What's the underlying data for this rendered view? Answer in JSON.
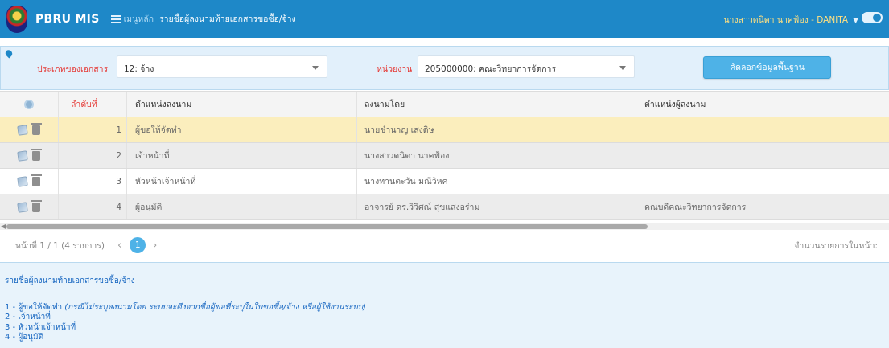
{
  "header": {
    "app_title": "PBRU MIS",
    "menu_label": "เมนูหลัก",
    "page_name": "รายชื่อผู้ลงนามท้ายเอกสารขอซื้อ/จ้าง",
    "user": "นางสาวดนิตา นาคฟ้อง - DANITA"
  },
  "filters": {
    "doc_type_label": "ประเภทของเอกสาร",
    "doc_type_value": "12: จ้าง",
    "unit_label": "หน่วยงาน",
    "unit_value": "205000000: คณะวิทยาการจัดการ",
    "copy_button": "คัดลอกข้อมูลพื้นฐาน"
  },
  "table": {
    "columns": [
      "ลำดับที่",
      "ตำแหน่งลงนาม",
      "ลงนามโดย",
      "ตำแหน่งผู้ลงนาม"
    ],
    "rows": [
      {
        "order": "1",
        "position": "ผู้ขอให้จัดทำ",
        "signer": "นายชำนาญ เส่งดิษ",
        "signer_position": ""
      },
      {
        "order": "2",
        "position": "เจ้าหน้าที่",
        "signer": "นางสาวดนิตา นาคฟ้อง",
        "signer_position": ""
      },
      {
        "order": "3",
        "position": "หัวหน้าเจ้าหน้าที่",
        "signer": "นางทานตะวัน มณีวิหค",
        "signer_position": ""
      },
      {
        "order": "4",
        "position": "ผู้อนุมัติ",
        "signer": "อาจารย์ ดร.วิวิศณ์ สุขแสงอร่าม",
        "signer_position": "คณบดีคณะวิทยาการจัดการ"
      }
    ]
  },
  "pager": {
    "info": "หน้าที่ 1 / 1 (4 รายการ)",
    "prev": "‹",
    "current": "1",
    "next": "›",
    "per_page_label": "จำนวนรายการในหน้า:"
  },
  "help": {
    "title": "รายชื่อผู้ลงนามท้ายเอกสารขอซื้อ/จ้าง",
    "line1_prefix": "1 - ผู้ขอให้จัดทำ",
    "line1_note": "(กรณีไม่ระบุลงนามโดย ระบบจะดึงจากชื่อผู้ขอที่ระบุในใบขอซื้อ/จ้าง หรือผู้ใช้งานระบบ)",
    "line2": "2 - เจ้าหน้าที่",
    "line3": "3 - หัวหน้าเจ้าหน้าที่",
    "line4": "4 - ผู้อนุมัติ"
  },
  "icons": {
    "logo": "university-logo",
    "menu": "list-icon",
    "filter": "pin-icon",
    "header_settings": "gear-icon",
    "edit": "pencil-icon",
    "delete": "trash-icon"
  },
  "colors": {
    "topbar": "#1e88c8",
    "accent": "#4eb2e7",
    "selected_row": "#fbeebd",
    "label_red": "#e53935",
    "user_name": "#ffe082"
  }
}
